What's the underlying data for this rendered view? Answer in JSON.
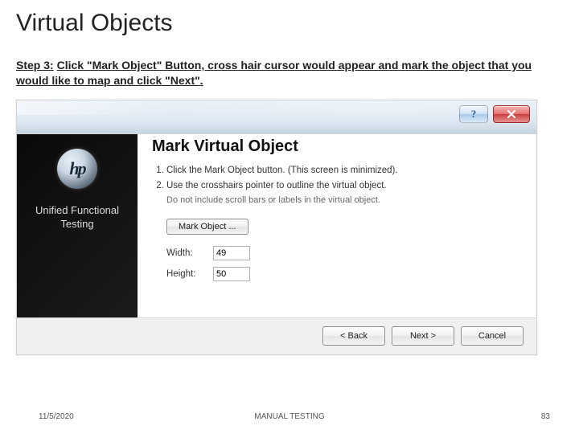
{
  "slide": {
    "title": "Virtual Objects",
    "step_prefix": "Step 3:",
    "instruction": "Click \"Mark Object\" Button, cross hair cursor would appear and mark the object that you would like to map and click \"Next\"."
  },
  "dialog": {
    "help_glyph": "?",
    "left_pane": {
      "logo_text": "hp",
      "product_line1": "Unified Functional",
      "product_line2": "Testing"
    },
    "wizard_title": "Mark Virtual Object",
    "steps": [
      {
        "text": "Click the Mark Object button. (This screen is minimized)."
      },
      {
        "text": "Use the crosshairs pointer to outline the virtual object.",
        "note": "Do not include scroll bars or labels in the virtual object."
      }
    ],
    "mark_button_label": "Mark Object ...",
    "width_label": "Width:",
    "width_value": "49",
    "height_label": "Height:",
    "height_value": "50",
    "buttons": {
      "back": "< Back",
      "next": "Next >",
      "cancel": "Cancel"
    }
  },
  "footer": {
    "date": "11/5/2020",
    "center": "MANUAL TESTING",
    "page": "83"
  }
}
